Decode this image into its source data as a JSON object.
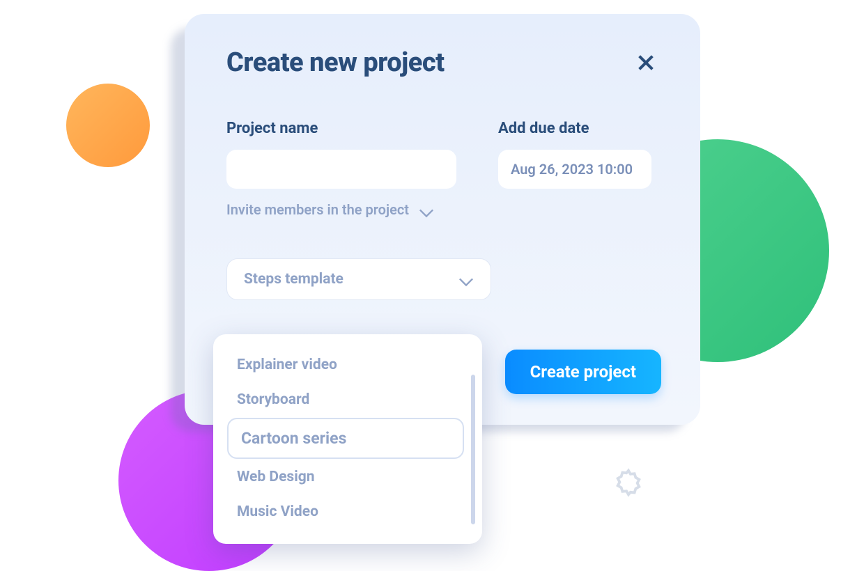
{
  "decor": {
    "colors": {
      "orange": "#ff9a3c",
      "green": "#2fc07a",
      "purple": "#c03cff"
    }
  },
  "modal": {
    "title": "Create new project",
    "close_icon": "close-icon",
    "fields": {
      "project_name": {
        "label": "Project name",
        "value": ""
      },
      "due_date": {
        "label": "Add due date",
        "value": "Aug 26, 2023 10:00"
      }
    },
    "invite": {
      "label": "Invite members in the project"
    },
    "template_select": {
      "label": "Steps template",
      "options": [
        {
          "label": "Explainer video",
          "selected": false
        },
        {
          "label": "Storyboard",
          "selected": false
        },
        {
          "label": "Cartoon series",
          "selected": true
        },
        {
          "label": "Web Design",
          "selected": false
        },
        {
          "label": "Music Video",
          "selected": false
        }
      ]
    },
    "submit_label": "Create project"
  }
}
